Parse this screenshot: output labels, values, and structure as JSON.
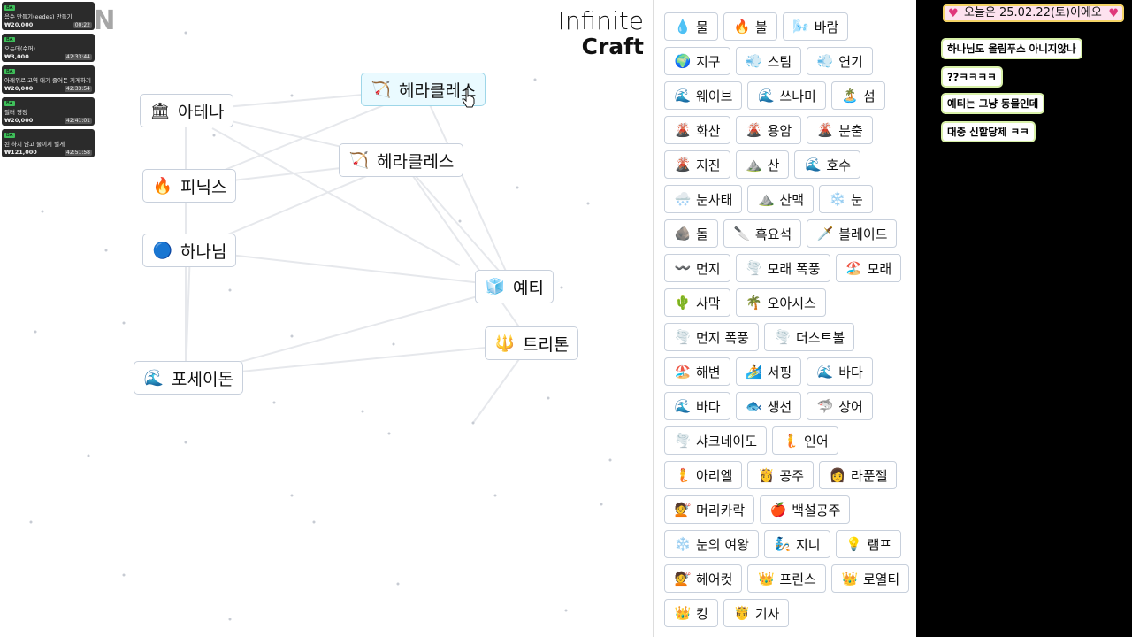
{
  "logo": {
    "line1": "Infinite",
    "line2": "Craft"
  },
  "canvas_nodes": [
    {
      "label": "헤라클레스",
      "icon": "bow-icon"
    },
    {
      "label": "아테나",
      "icon": "temple-icon"
    },
    {
      "label": "헤라클레스",
      "icon": "bow-icon"
    },
    {
      "label": "피닉스",
      "icon": "fire-icon"
    },
    {
      "label": "하나님",
      "icon": "orb-icon"
    },
    {
      "label": "예티",
      "icon": "ice-cube-icon"
    },
    {
      "label": "트리톤",
      "icon": "trident-icon"
    },
    {
      "label": "포세이돈",
      "icon": "wave-icon"
    }
  ],
  "sidebar_items": [
    {
      "label": "물",
      "emoji": "💧"
    },
    {
      "label": "불",
      "emoji": "🔥"
    },
    {
      "label": "바람",
      "emoji": "🌬️"
    },
    {
      "label": "지구",
      "emoji": "🌍"
    },
    {
      "label": "스팀",
      "emoji": "💨"
    },
    {
      "label": "연기",
      "emoji": "💨"
    },
    {
      "label": "웨이브",
      "emoji": "🌊"
    },
    {
      "label": "쓰나미",
      "emoji": "🌊"
    },
    {
      "label": "섬",
      "emoji": "🏝️"
    },
    {
      "label": "화산",
      "emoji": "🌋"
    },
    {
      "label": "용암",
      "emoji": "🌋"
    },
    {
      "label": "분출",
      "emoji": "🌋"
    },
    {
      "label": "지진",
      "emoji": "🌋"
    },
    {
      "label": "산",
      "emoji": "⛰️"
    },
    {
      "label": "호수",
      "emoji": "🌊"
    },
    {
      "label": "눈사태",
      "emoji": "🌨️"
    },
    {
      "label": "산맥",
      "emoji": "⛰️"
    },
    {
      "label": "눈",
      "emoji": "❄️"
    },
    {
      "label": "돌",
      "emoji": "🪨"
    },
    {
      "label": "흑요석",
      "emoji": "🔪"
    },
    {
      "label": "블레이드",
      "emoji": "🗡️"
    },
    {
      "label": "먼지",
      "emoji": "〰️"
    },
    {
      "label": "모래 폭풍",
      "emoji": "🌪️"
    },
    {
      "label": "모래",
      "emoji": "🏖️"
    },
    {
      "label": "사막",
      "emoji": "🌵"
    },
    {
      "label": "오아시스",
      "emoji": "🌴"
    },
    {
      "label": "먼지 폭풍",
      "emoji": "🌪️"
    },
    {
      "label": "더스트볼",
      "emoji": "🌪️"
    },
    {
      "label": "해변",
      "emoji": "🏖️"
    },
    {
      "label": "서핑",
      "emoji": "🏄"
    },
    {
      "label": "바다",
      "emoji": "🌊"
    },
    {
      "label": "바다",
      "emoji": "🌊"
    },
    {
      "label": "생선",
      "emoji": "🐟"
    },
    {
      "label": "상어",
      "emoji": "🦈"
    },
    {
      "label": "샤크네이도",
      "emoji": "🌪️"
    },
    {
      "label": "인어",
      "emoji": "🧜"
    },
    {
      "label": "아리엘",
      "emoji": "🧜"
    },
    {
      "label": "공주",
      "emoji": "👸"
    },
    {
      "label": "라푼젤",
      "emoji": "👩"
    },
    {
      "label": "머리카락",
      "emoji": "💇"
    },
    {
      "label": "백설공주",
      "emoji": "🍎"
    },
    {
      "label": "눈의 여왕",
      "emoji": "❄️"
    },
    {
      "label": "지니",
      "emoji": "🧞"
    },
    {
      "label": "램프",
      "emoji": "💡"
    },
    {
      "label": "헤어컷",
      "emoji": "💇"
    },
    {
      "label": "프린스",
      "emoji": "👑"
    },
    {
      "label": "로열티",
      "emoji": "👑"
    },
    {
      "label": "킹",
      "emoji": "👑"
    },
    {
      "label": "기사",
      "emoji": "🤴"
    }
  ],
  "stream_overlay": [
    {
      "tag": "BA",
      "title": "음수 만들기(eedes) 만들기",
      "price": "₩20,000",
      "time": "00:22"
    },
    {
      "tag": "BA",
      "title": "오는데(수퍼)",
      "price": "₩3,000",
      "time": "42:33:44"
    },
    {
      "tag": "BA",
      "title": "아래위로 고역 대기 줄어든 지게하기",
      "price": "₩20,000",
      "time": "42:33:54"
    },
    {
      "tag": "BA",
      "title": "필터 영정",
      "price": "₩20,000",
      "time": "42:41:01"
    },
    {
      "tag": "BA",
      "title": "된 하지 않고 줄이지 벌게",
      "price": "₩121,000",
      "time": "42:51:58"
    }
  ],
  "chat": {
    "top": "오늘은 25.02.22(토)이에오",
    "messages": [
      "하나님도 올림푸스 아니지않나",
      "??ㅋㅋㅋㅋ",
      "예티는 그냥 동물인데",
      "대충 신할당제 ㅋㅋ"
    ]
  }
}
